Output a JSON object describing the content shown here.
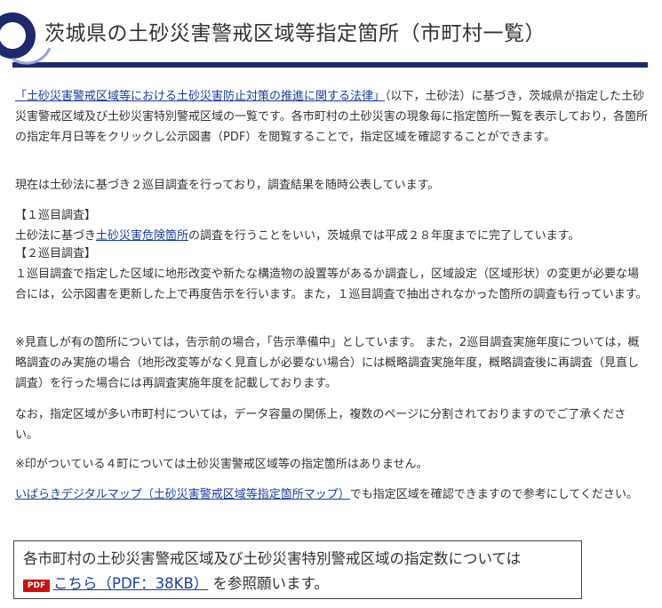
{
  "heading": {
    "title": "茨城県の土砂災害警戒区域等指定箇所（市町村一覧）"
  },
  "intro": {
    "law_link": "「土砂災害警戒区域等における土砂災害防止対策の推進に関する法律」",
    "after_link": "（以下，土砂法）に基づき，茨城県が指定した土砂災害警戒区域及び土砂災害特別警戒区域の一覧です。各市町村の土砂災害の現象毎に指定箇所一覧を表示しており，各箇所の指定年月日等をクリックし公示図書（PDF）を閲覧することで，指定区域を確認することができます。"
  },
  "survey_status": "現在は土砂法に基づき２巡目調査を行っており，調査結果を随時公表しています。",
  "first_survey": {
    "heading": "【１巡目調査】",
    "before_link": "土砂法に基づき",
    "link": "土砂災害危険箇所",
    "after_link": "の調査を行うことをいい，茨城県では平成２８年度までに完了しています。"
  },
  "second_survey": {
    "heading": "【２巡目調査】",
    "body": "１巡目調査で指定した区域に地形改変や新たな構造物の設置等があるか調査し，区域設定（区域形状）の変更が必要な場合には，公示図書を更新した上で再度告示を行います。また，１巡目調査で抽出されなかった箇所の調査も行っています。"
  },
  "note_review": "※見直しが有の箇所については，告示前の場合，「告示準備中」としています。 また，2巡目調査実施年度については，概略調査のみ実施の場合（地形改変等がなく見直しが必要ない場合）には概略調査実施年度，概略調査後に再調査（見直し調査）を行った場合には再調査実施年度を記載しております。",
  "note_split": "なお，指定区域が多い市町村については，データ容量の関係上，複数のページに分割されておりますのでご了承ください。",
  "note_towns": "※印がついている４町については土砂災害警戒区域等の指定箇所はありません。",
  "digital_map": {
    "link": "いばらきデジタルマップ（土砂災害警戒区域等指定箇所マップ）",
    "after_link": "でも指定区域を確認できますので参考にしてください。"
  },
  "info_box": {
    "line1": "各市町村の土砂災害警戒区域及び土砂災害特別警戒区域の指定数については",
    "pdf_icon_label": "PDF",
    "pdf_link": "こちら（PDF：38KB）",
    "after_link": "を参照願います。"
  },
  "colors": {
    "heading_bar": "#1f2a6e",
    "link": "#1a3fa0",
    "pdf_icon": "#cc1111"
  }
}
